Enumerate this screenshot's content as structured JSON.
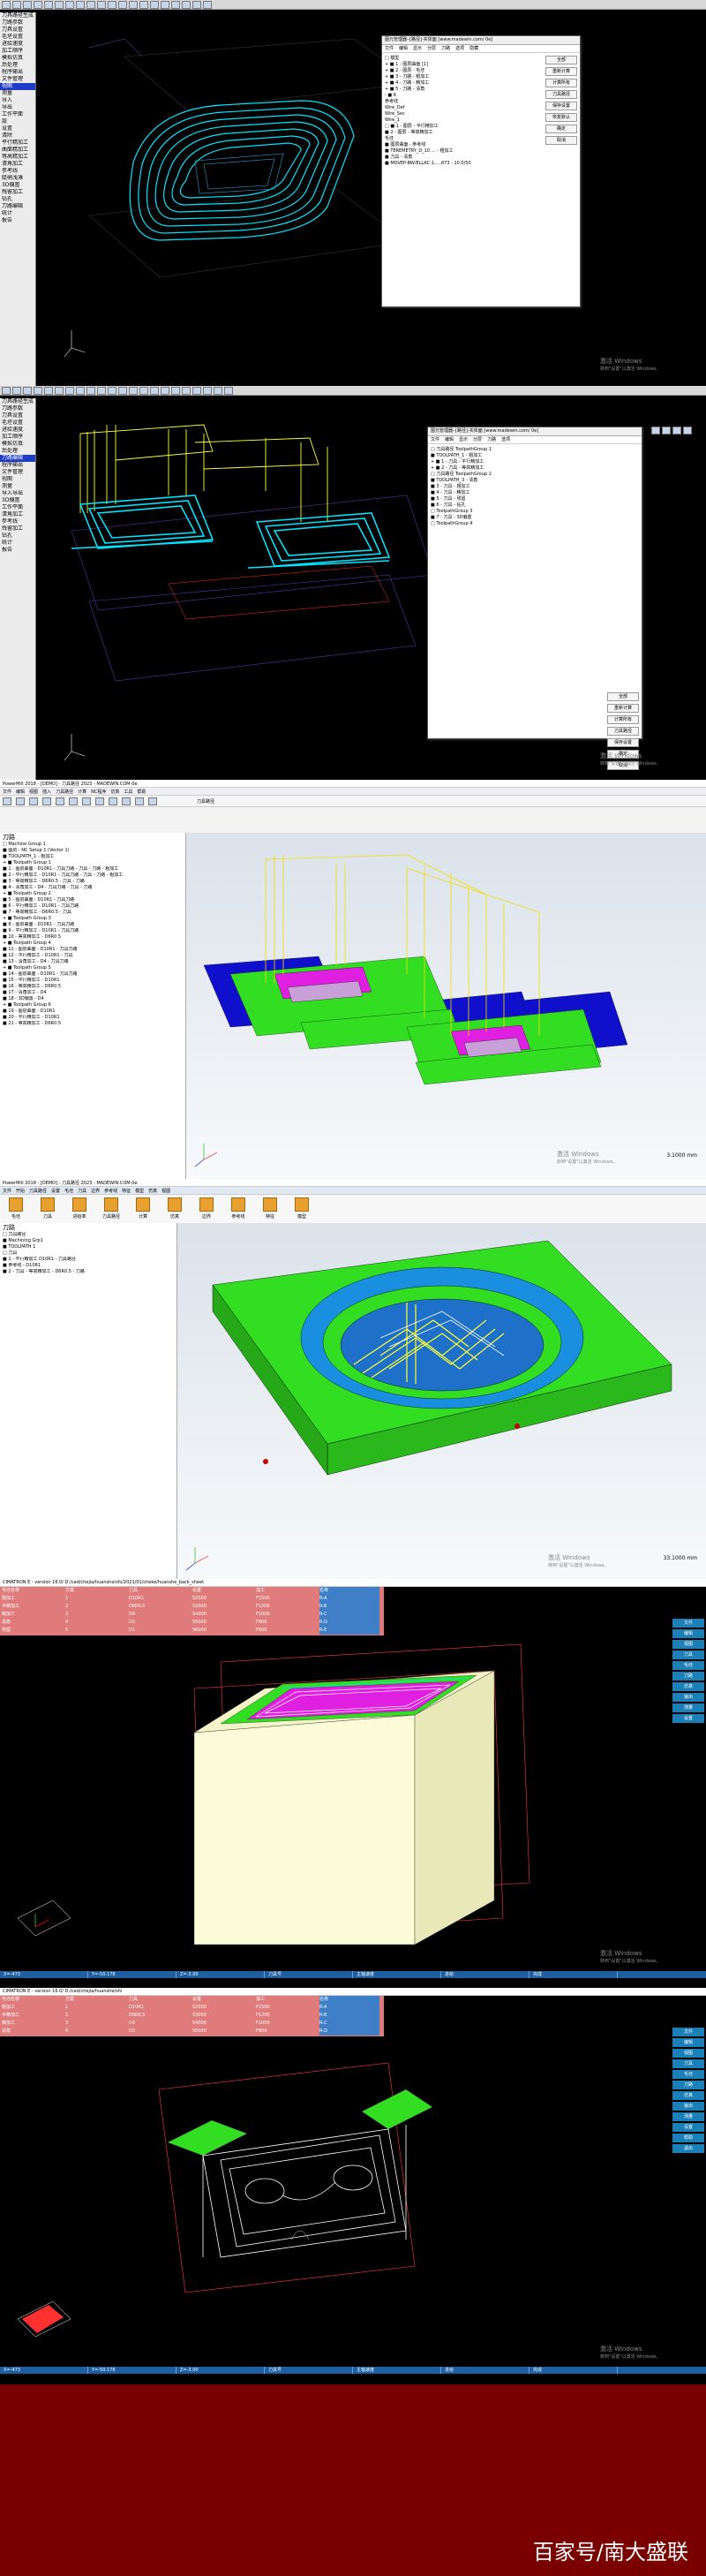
{
  "panel1": {
    "menu": [
      "刀具路径生成",
      "刀路参数",
      "刀具设置",
      "毛坯设置",
      "进给速度",
      "加工顺序",
      "模拟仿真",
      "后处理",
      "程序输出",
      "文件管理",
      "视图",
      "测量",
      "导入",
      "导出",
      "工作平面",
      "层",
      "设置",
      "清除",
      "平行精加工",
      "曲面精加工",
      "等高精加工",
      "清角加工",
      "参考线",
      "陡峭浅滩",
      "3D偏置",
      "残留加工",
      "钻孔",
      "刀路编辑",
      "统计",
      "报告"
    ],
    "menu_selected_index": 10,
    "dialog": {
      "title": "图元管理器-{路径]-实体面 [www.madewin.com/ 0e]",
      "tabs": [
        "文件",
        "编辑",
        "显示",
        "分层",
        "刀路",
        "选项",
        "隐藏"
      ],
      "tree": [
        "□ 模型",
        "+ ■ 1 - 图层曲面 [1]",
        "+ ■ 2 - 图层 - 毛坯",
        "+ ■ 3 - 刀路 - 粗加工",
        "+ ■ 4 - 刀路 - 精加工",
        "+ ■ 5 - 刀路 - 清角",
        "- ■ 6",
        "  参考线",
        "  Wire_Def",
        "  Wire_Sec",
        "  Wire_1",
        "□ ■ 1 - 图层 - 平行精加工",
        "   ■ 2 - 图层 - 等高精加工",
        "  毛坯",
        "  ■ 图层曲面 - 参考线",
        "   ■ TEREMETRY_D_10 ... - 粗加工",
        "   ■ 刀具 - 清角",
        "   ■ MOVEP-BW/ELLAC:1,...,873 - 10.0/50"
      ],
      "buttons": [
        "全部",
        "重新计算",
        "计算所有",
        "刀具路径",
        "保存设置",
        "恢复默认",
        "确定",
        "取消"
      ]
    },
    "watermark_title": "激活 Windows",
    "watermark_sub": "转到\"设置\"以激活 Windows。"
  },
  "panel2": {
    "menu": [
      "刀具路径生成",
      "刀路参数",
      "刀具设置",
      "毛坯设置",
      "进给速度",
      "加工顺序",
      "模拟仿真",
      "后处理",
      "刀路编辑",
      "程序输出",
      "文件管理",
      "视图",
      "测量",
      "导入导出",
      "3D偏置",
      "工作平面",
      "清角加工",
      "参考线",
      "残留加工",
      "钻孔",
      "统计",
      "报告"
    ],
    "menu_selected_index": 8,
    "dialog": {
      "title": "图元管理器-{路径]-实体面 [www.madewin.com/ 0e]",
      "tabs": [
        "文件",
        "编辑",
        "显示",
        "分层",
        "刀路",
        "选项"
      ],
      "tree": [
        "□ 刀具路径 ToolpathGroup 1",
        "  ■ TOOLPATH_1 - 粗加工",
        "+ ■ 1 - 刀具 - 平行精加工",
        "+ ■ 2 - 刀具 - 等高精加工",
        "□ 刀具路径 ToolpathGroup 2",
        "  ■ TOOLPATH_3 - 清角",
        "  ■ 3 - 刀具 - 粗加工",
        "  ■ 4 - 刀具 - 精加工",
        "  ■ 5 - 刀具 - 残留",
        "  ■ 6 - 刀具 - 钻孔",
        "□ ToolpathGroup 3",
        "  ■ 7 - 刀具 - 3D偏置",
        "□ ToolpathGroup 4"
      ],
      "buttons": [
        "全部",
        "重新计算",
        "计算所有",
        "刀具路径",
        "保存设置",
        "确定",
        "取消"
      ]
    },
    "watermark_title": "激活 Windows",
    "watermark_sub": "转到\"设置\"以激活 Windows。"
  },
  "panel3": {
    "title": "PowerMill 2018 - [DEMO] - 刀具路径 2023 - MADEWIN.COM-0e",
    "menu": [
      "文件",
      "编辑",
      "视图",
      "插入",
      "刀具路径",
      "计算",
      "NC程序",
      "仿真",
      "工具",
      "帮助"
    ],
    "toolbar_label": "刀具路径",
    "explorer_title": "刀路",
    "tree": [
      "□ Machine Group 1",
      "  ■ 图层 - NC Setup 1 (Vector 1)",
      "  ■ TOOLPATH_1 - 粗加工",
      "+ ■ Toolpath Group 1",
      "   ■ 1 - 图层曲面 - D10R1 - 刀具刀路 - 刀具 - 刀路 - 粗加工",
      "   ■ 2 - 平行精加工 - D10R1 - 刀具刀路 - 刀具 - 刀路 - 粗加工",
      "   ■ 3 - 等高精加工 - D6R0.5 - 刀具 - 刀路",
      "   ■ 4 - 清角加工 - D4 - 刀具刀路 - 刀具 - 刀路",
      "+ ■ Toolpath Group 2",
      "   ■ 5 - 图层曲面 - D10R1 - 刀具刀路",
      "   ■ 6 - 平行精加工 - D10R1 - 刀具刀路",
      "   ■ 7 - 等高精加工 - D6R0.5 - 刀具",
      "+ ■ Toolpath Group 3",
      "   ■ 8 - 图层曲面 - D10R1 - 刀具刀路",
      "   ■ 9 - 平行精加工 - D10R1 - 刀具刀路",
      "   ■ 10 - 等高精加工 - D6R0.5",
      "+ ■ Toolpath Group 4",
      "   ■ 11 - 图层曲面 - D10R1 - 刀具刀路",
      "   ■ 12 - 平行精加工 - D10R1 - 刀具",
      "   ■ 13 - 清角加工 - D4 - 刀具刀路",
      "+ ■ Toolpath Group 5",
      "   ■ 14 - 图层曲面 - D10R1 - 刀具刀路",
      "   ■ 15 - 平行精加工 - D10R1",
      "   ■ 16 - 等高精加工 - D6R0.5",
      "   ■ 17 - 清角加工 - D4",
      "   ■ 18 - 3D偏置 - D4",
      "+ ■ Toolpath Group 6",
      "   ■ 19 - 图层曲面 - D10R1",
      "   ■ 20 - 平行精加工 - D10R1",
      "   ■ 21 - 等高精加工 - D6R0.5"
    ],
    "watermark_title": "激活 Windows",
    "watermark_sub": "转到\"设置\"以激活 Windows。",
    "status_value": "3.1000 mm"
  },
  "panel4": {
    "title": "PowerMill 2018 - [DEMO] - 刀具路径 2023 - MADEWIN.COM-0e",
    "ribbon_tabs": [
      "文件",
      "开始",
      "刀具路径",
      "设置",
      "毛坯",
      "刀具",
      "边界",
      "参考线",
      "特征",
      "模型",
      "仿真",
      "视图"
    ],
    "ribbon_buttons": [
      "毛坯",
      "刀具",
      "进给率",
      "刀具路径",
      "计算",
      "仿真",
      "边界",
      "参考线",
      "特征",
      "模型"
    ],
    "explorer_title": "刀路",
    "tree": [
      "□ 刀具路径",
      "  ■ Machining Grp1",
      "  ■ TOOLPATH 1",
      "□ 刀具",
      "  ■ 1 - 平行精加工 D10R1 - 刀具路径",
      "   ■ 参考线 - D10R1",
      "   ■ 2 - 刀具 - 等高精加工 - D6R0.5 - 刀路"
    ],
    "watermark_title": "激活 Windows",
    "watermark_sub": "转到\"设置\"以激活 Windows。",
    "status_value": "33.1000 mm"
  },
  "panel5": {
    "title": "CIMATRON E - version 16.0/ D:/cad/chejia/huanshe/shi/2021/01/cheke/huanshe_back_sheet",
    "table_rows": [
      [
        "毛坯名称",
        "方案",
        "刀具",
        "设置",
        "加工",
        "名称"
      ],
      [
        "粗加工",
        "1",
        "D10R1",
        "S2500",
        "F1500",
        "R-A"
      ],
      [
        "半精加工",
        "2",
        "D6R0.5",
        "S3000",
        "F1200",
        "R-B"
      ],
      [
        "精加工",
        "3",
        "D4",
        "S4000",
        "F1000",
        "R-C"
      ],
      [
        "清角",
        "4",
        "D2",
        "S5000",
        "F800",
        "R-D"
      ],
      [
        "残留",
        "5",
        "D1",
        "S6000",
        "F600",
        "R-E"
      ]
    ],
    "right_tools": [
      "文件",
      "编辑",
      "视图",
      "刀具",
      "毛坯",
      "刀路",
      "仿真",
      "输出",
      "测量",
      "设置"
    ],
    "status": [
      "X=-473",
      "Y=-50.178",
      "Z=-3.00",
      "刀具号",
      "主轴速度",
      "进给",
      "完成"
    ],
    "watermark_title": "激活 Windows",
    "watermark_sub": "转到\"设置\"以激活 Windows。"
  },
  "panel6": {
    "title": "CIMATRON E - version 16.0/ D:/cad/chejia/huanshe/shi",
    "table_rows": [
      [
        "毛坯名称",
        "方案",
        "刀具",
        "设置",
        "加工",
        "名称"
      ],
      [
        "粗加工",
        "1",
        "D10R1",
        "S2500",
        "F1500",
        "R-A"
      ],
      [
        "半精加工",
        "2",
        "D6R0.5",
        "S3000",
        "F1200",
        "R-B"
      ],
      [
        "精加工",
        "3",
        "D4",
        "S4000",
        "F1000",
        "R-C"
      ],
      [
        "清角",
        "4",
        "D2",
        "S5000",
        "F800",
        "R-D"
      ]
    ],
    "right_tools": [
      "文件",
      "编辑",
      "视图",
      "刀具",
      "毛坯",
      "刀路",
      "仿真",
      "输出",
      "测量",
      "设置",
      "帮助",
      "退出"
    ],
    "status": [
      "X=-473",
      "Y=-50.178",
      "Z=-3.00",
      "刀具号",
      "主轴速度",
      "进给",
      "完成"
    ],
    "watermark_title": "激活 Windows",
    "watermark_sub": "转到\"设置\"以激活 Windows。"
  },
  "footer": {
    "brand": "百家号/南大盛联"
  },
  "colors": {
    "viewport_dark": "#000000",
    "cyan_path": "#00e5ff",
    "yellow_path": "#ffff33",
    "green_part": "#33dd22",
    "magenta_part": "#e020e0",
    "blue_part": "#1010cc",
    "footer_bg": "#7a0000"
  }
}
